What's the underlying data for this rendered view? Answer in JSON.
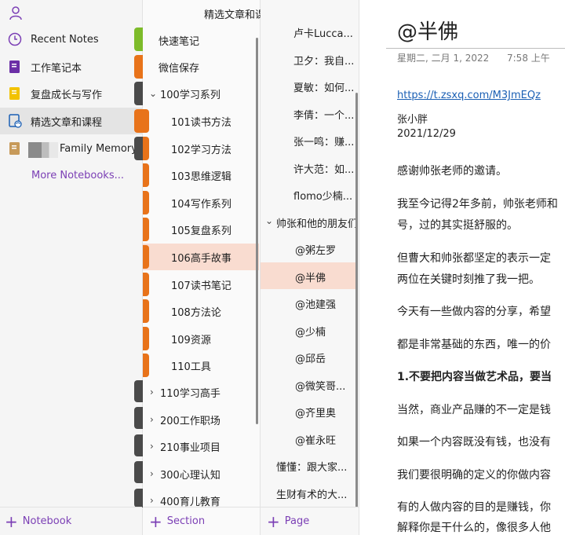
{
  "colors": {
    "accent": "#7b3fb5",
    "selected_section_bg": "#f9dcd0",
    "tab_orange": "#e8731a",
    "tab_green": "#7dbb2a",
    "tab_dark": "#4a4a4a"
  },
  "notebooks": {
    "items": [
      {
        "label": "Recent Notes",
        "icon": "clock-icon"
      },
      {
        "label": "工作笔记本",
        "icon": "notebook-purple-icon"
      },
      {
        "label": "复盘成长与写作",
        "icon": "notebook-yellow-icon"
      },
      {
        "label": "精选文章和课程",
        "icon": "notebook-sync-icon"
      },
      {
        "label": "Family Memory",
        "icon": "notebook-tan-icon"
      }
    ],
    "more": "More Notebooks...",
    "add_label": "Notebook"
  },
  "sections": {
    "title": "精选文章和课程",
    "items": [
      {
        "label": "快速笔记"
      },
      {
        "label": "微信保存"
      },
      {
        "label": "100学习系列"
      },
      {
        "label": "101读书方法"
      },
      {
        "label": "102学习方法"
      },
      {
        "label": "103思维逻辑"
      },
      {
        "label": "104写作系列"
      },
      {
        "label": "105复盘系列"
      },
      {
        "label": "106高手故事"
      },
      {
        "label": "107读书笔记"
      },
      {
        "label": "108方法论"
      },
      {
        "label": "109资源"
      },
      {
        "label": "110工具"
      },
      {
        "label": "110学习高手"
      },
      {
        "label": "200工作职场"
      },
      {
        "label": "210事业项目"
      },
      {
        "label": "300心理认知"
      },
      {
        "label": "400育儿教育"
      }
    ],
    "add_label": "Section"
  },
  "pages": {
    "items": [
      {
        "label": "卢卡Lucca..."
      },
      {
        "label": "卫夕：我自..."
      },
      {
        "label": "夏敏：如何..."
      },
      {
        "label": "李倩：一个..."
      },
      {
        "label": "张一鸣：赚..."
      },
      {
        "label": "许大范：如..."
      },
      {
        "label": "flomo少楠..."
      },
      {
        "label": "帅张和他的朋友们"
      },
      {
        "label": "@粥左罗"
      },
      {
        "label": "@半佛"
      },
      {
        "label": "@池建强"
      },
      {
        "label": "@少楠"
      },
      {
        "label": "@邱岳"
      },
      {
        "label": "@微笑哥..."
      },
      {
        "label": "@齐里奥"
      },
      {
        "label": "@崔永旺"
      },
      {
        "label": "懂懂：跟大家..."
      },
      {
        "label": "生财有术的大..."
      }
    ],
    "add_label": "Page"
  },
  "note": {
    "title": "@半佛",
    "date": "星期二, 二月 1, 2022",
    "time": "7:58 上午",
    "link": "https://t.zsxq.com/M3JmEQz",
    "author": "张小胖",
    "author_date": "2021/12/29",
    "paragraphs": [
      "感谢帅张老师的邀请。",
      "我至今记得2年多前，帅张老师和",
      "号，过的其实挺舒服的。",
      "但曹大和帅张都坚定的表示一定",
      "两位在关键时刻推了我一把。",
      "今天有一些做内容的分享，希望",
      "都是非常基础的东西，唯一的价",
      "1.不要把内容当做艺术品，要当",
      "当然，商业产品赚的不一定是钱",
      "如果一个内容既没有钱，也没有",
      "我们要很明确的定义的你做内容",
      "有的人做内容的目的是赚钱，你",
      "解释你是干什么的，像很多人他"
    ]
  }
}
